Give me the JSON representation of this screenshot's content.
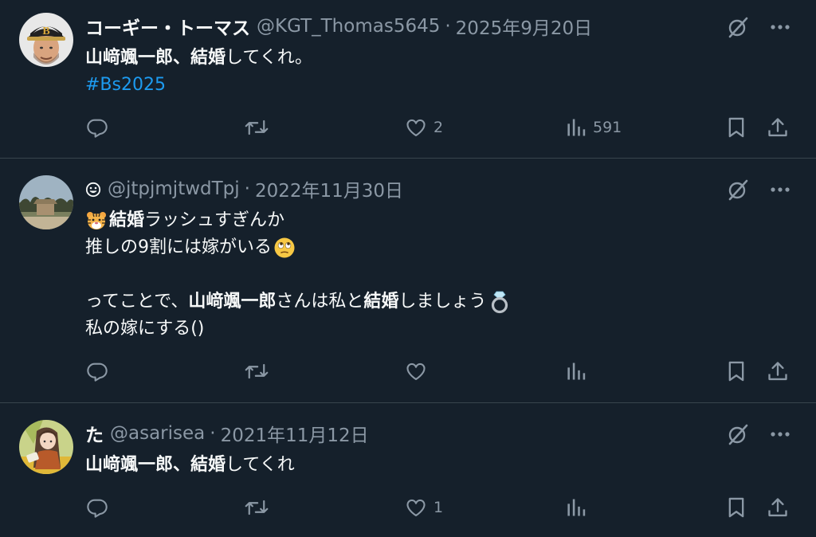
{
  "tweets": [
    {
      "name": "コーギー・トーマス",
      "handle": "@KGT_Thomas5645",
      "separator": "·",
      "date": "2025年9月20日",
      "lines": [
        [
          {
            "text": "山﨑颯一郎",
            "bold": true
          },
          {
            "text": "、",
            "bold": true
          },
          {
            "text": "結婚",
            "bold": true
          },
          {
            "text": "してくれ。"
          }
        ],
        [
          {
            "text": "#Bs2025",
            "hashtag": true
          }
        ]
      ],
      "likes": "2",
      "views": "591",
      "avatar": "player-photo"
    },
    {
      "name": "",
      "handle": "@jtpjmjtwdTpj",
      "separator": "·",
      "date": "2022年11月30日",
      "lines": [
        [
          {
            "emoji": "tiger-face"
          },
          {
            "text": "結婚",
            "bold": true
          },
          {
            "text": "ラッシュすぎんか"
          }
        ],
        [
          {
            "text": "推しの9割には嫁がいる"
          },
          {
            "emoji": "eye-roll-face"
          }
        ],
        [],
        [
          {
            "text": "ってことで、"
          },
          {
            "text": "山﨑颯一郎",
            "bold": true
          },
          {
            "text": "さんは私と"
          },
          {
            "text": "結婚",
            "bold": true
          },
          {
            "text": "しましょう"
          },
          {
            "emoji": "ring"
          }
        ],
        [
          {
            "text": "私の嫁にする()"
          }
        ]
      ],
      "likes": "",
      "views": "",
      "avatar": "trees-landscape"
    },
    {
      "name": "た",
      "handle": "@asarisea",
      "separator": "·",
      "date": "2021年11月12日",
      "lines": [
        [
          {
            "text": "山﨑颯一郎",
            "bold": true
          },
          {
            "text": "、",
            "bold": true
          },
          {
            "text": "結婚",
            "bold": true
          },
          {
            "text": "してくれ"
          }
        ]
      ],
      "likes": "1",
      "views": "",
      "avatar": "illustrated-girl"
    }
  ],
  "icons": {
    "grok": "grok-icon",
    "more": "more-icon",
    "reply": "reply-icon",
    "retweet": "retweet-icon",
    "like": "like-icon",
    "views": "views-icon",
    "bookmark": "bookmark-icon",
    "share": "share-icon"
  },
  "colors": {
    "background": "#15202b",
    "text": "#f7f9f9",
    "muted": "#8b98a5",
    "hashtag": "#1d9bf0",
    "divider": "#38444d"
  }
}
